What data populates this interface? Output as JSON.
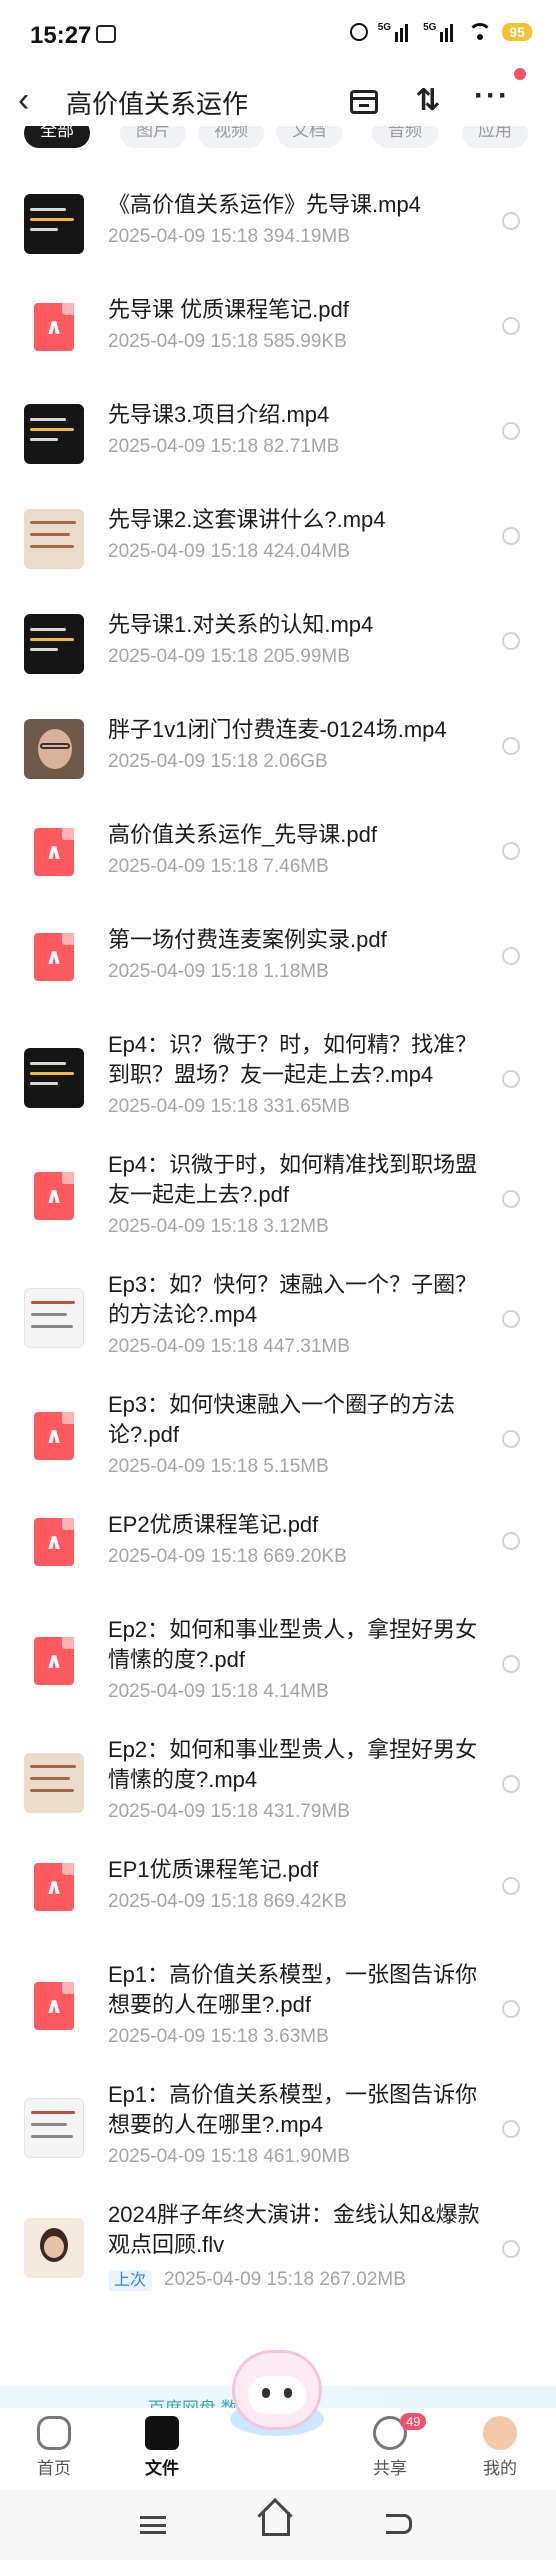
{
  "status_bar": {
    "time": "15:27",
    "net1": "5G",
    "net2": "5G",
    "battery": "95"
  },
  "header": {
    "title": "高价值关系运作"
  },
  "tabs": [
    {
      "label": "全部",
      "active": true
    },
    {
      "label": "图片"
    },
    {
      "label": "视频"
    },
    {
      "label": "文档"
    },
    {
      "label": "音频"
    },
    {
      "label": "应用"
    }
  ],
  "files": [
    {
      "type": "video",
      "thumb": "dark",
      "name": "《高价值关系运作》先导课.mp4",
      "date": "2025-04-09  15:18",
      "size": "394.19MB"
    },
    {
      "type": "pdf",
      "name": "先导课 优质课程笔记.pdf",
      "date": "2025-04-09  15:18",
      "size": "585.99KB"
    },
    {
      "type": "video",
      "thumb": "dark",
      "name": "先导课3.项目介绍.mp4",
      "date": "2025-04-09  15:18",
      "size": "82.71MB"
    },
    {
      "type": "video",
      "thumb": "beige",
      "name": "先导课2.这套课讲什么?.mp4",
      "date": "2025-04-09  15:18",
      "size": "424.04MB"
    },
    {
      "type": "video",
      "thumb": "dark",
      "name": "先导课1.对关系的认知.mp4",
      "date": "2025-04-09  15:18",
      "size": "205.99MB"
    },
    {
      "type": "video",
      "thumb": "face",
      "name": "胖子1v1闭门付费连麦-0124场.mp4",
      "date": "2025-04-09  15:18",
      "size": "2.06GB"
    },
    {
      "type": "pdf",
      "name": "高价值关系运作_先导课.pdf",
      "date": "2025-04-09  15:18",
      "size": "7.46MB"
    },
    {
      "type": "pdf",
      "name": "第一场付费连麦案例实录.pdf",
      "date": "2025-04-09  15:18",
      "size": "1.18MB"
    },
    {
      "type": "video",
      "thumb": "dark",
      "name": "Ep4：识？微于？时，如何精？找准？到职？盟场？友一起走上去?.mp4",
      "date": "2025-04-09  15:18",
      "size": "331.65MB"
    },
    {
      "type": "pdf",
      "name": "Ep4：识微于时，如何精准找到职场盟友一起走上去?.pdf",
      "date": "2025-04-09  15:18",
      "size": "3.12MB"
    },
    {
      "type": "video",
      "thumb": "white",
      "name": "Ep3：如？快何？速融入一个？子圈？的方法论?.mp4",
      "date": "2025-04-09  15:18",
      "size": "447.31MB"
    },
    {
      "type": "pdf",
      "name": "Ep3：如何快速融入一个圈子的方法论?.pdf",
      "date": "2025-04-09  15:18",
      "size": "5.15MB"
    },
    {
      "type": "pdf",
      "name": "EP2优质课程笔记.pdf",
      "date": "2025-04-09  15:18",
      "size": "669.20KB"
    },
    {
      "type": "pdf",
      "name": "Ep2：如何和事业型贵人，拿捏好男女情愫的度?.pdf",
      "date": "2025-04-09  15:18",
      "size": "4.14MB"
    },
    {
      "type": "video",
      "thumb": "beige",
      "name": "Ep2：如何和事业型贵人，拿捏好男女情愫的度?.mp4",
      "date": "2025-04-09  15:18",
      "size": "431.79MB"
    },
    {
      "type": "pdf",
      "name": "EP1优质课程笔记.pdf",
      "date": "2025-04-09  15:18",
      "size": "869.42KB"
    },
    {
      "type": "pdf",
      "name": "Ep1：高价值关系模型，一张图告诉你想要的人在哪里?.pdf",
      "date": "2025-04-09  15:18",
      "size": "3.63MB"
    },
    {
      "type": "video",
      "thumb": "white",
      "name": "Ep1：高价值关系模型，一张图告诉你想要的人在哪里?.mp4",
      "date": "2025-04-09  15:18",
      "size": "461.90MB"
    },
    {
      "type": "video",
      "thumb": "warm",
      "name": "2024胖子年终大演讲：金线认知&爆款观点回顾.flv",
      "date": "2025-04-09  15:18",
      "size": "267.02MB",
      "tag": "上次"
    }
  ],
  "banner": {
    "text": "百度网盘  数据安全 >"
  },
  "bottom_nav": [
    {
      "label": "首页",
      "icon": "home-icon"
    },
    {
      "label": "文件",
      "icon": "folder-icon",
      "active": true
    },
    {
      "label": "",
      "icon": "mascot-icon"
    },
    {
      "label": "共享",
      "icon": "share-icon",
      "badge": "49"
    },
    {
      "label": "我的",
      "icon": "avatar-icon"
    }
  ],
  "colors": {
    "pdf_icon": "#ff5a5f",
    "accent_blue": "#2f87e6",
    "badge_red": "#f2516b",
    "battery": "#f2c230"
  }
}
